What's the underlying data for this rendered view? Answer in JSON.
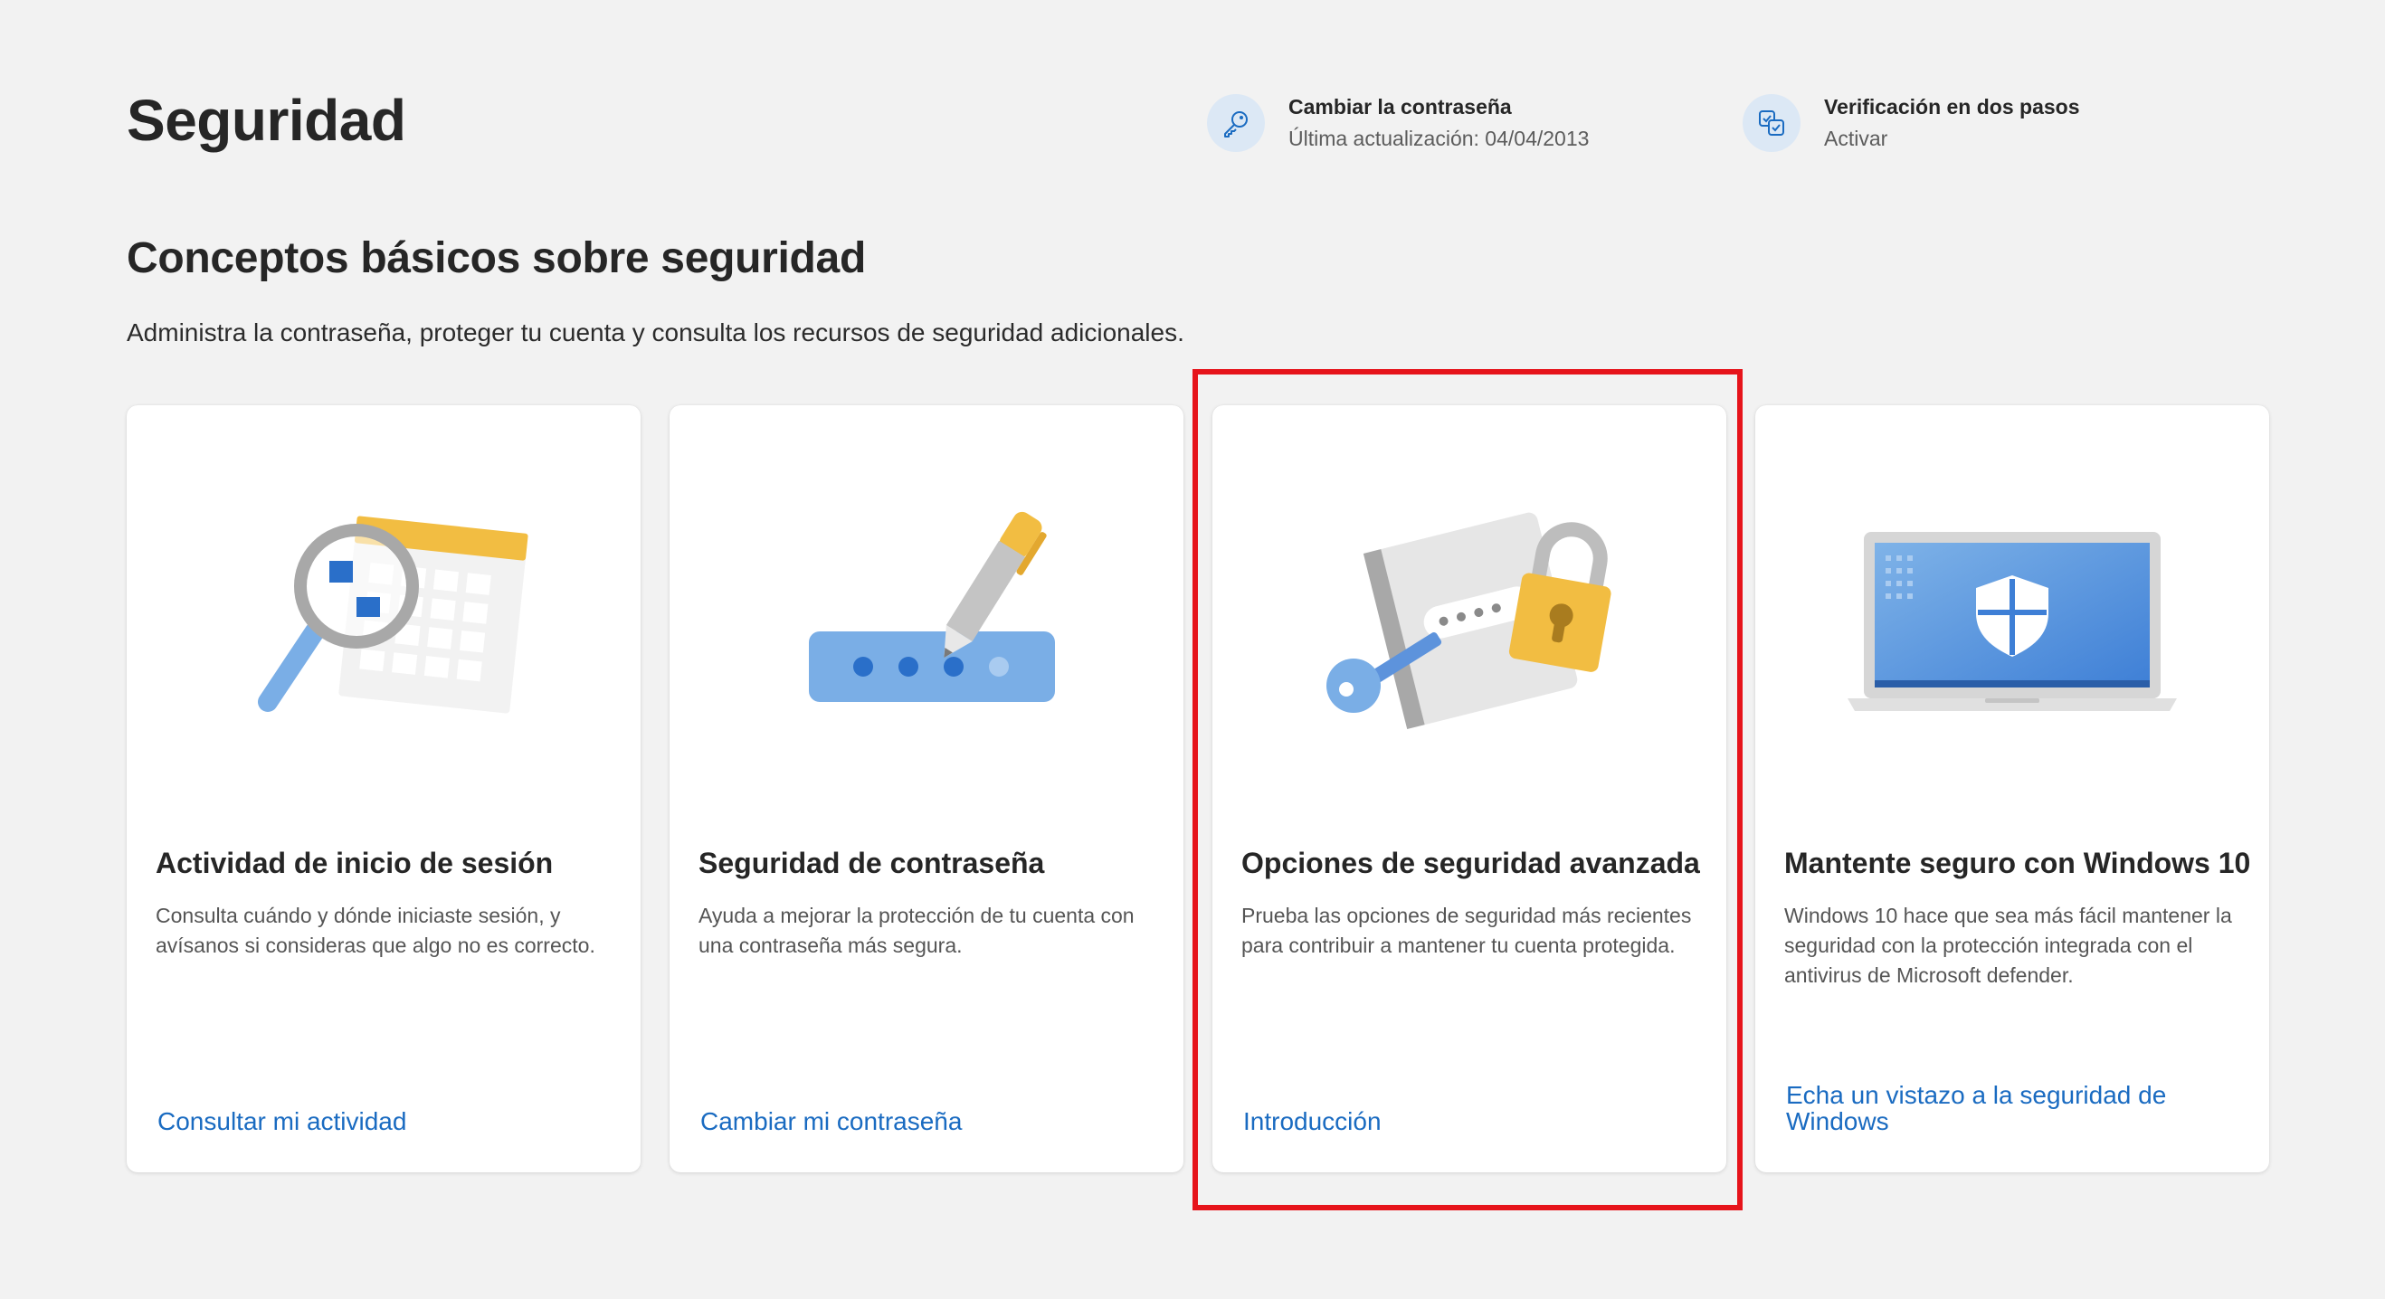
{
  "page": {
    "title": "Seguridad"
  },
  "quick_actions": [
    {
      "icon": "key-icon",
      "title": "Cambiar la contraseña",
      "subtitle": "Última actualización: 04/04/2013"
    },
    {
      "icon": "two-step-verification-icon",
      "title": "Verificación en dos pasos",
      "subtitle": "Activar"
    }
  ],
  "section": {
    "title": "Conceptos básicos sobre seguridad",
    "description": "Administra la contraseña, proteger tu cuenta y consulta los recursos de seguridad adicionales."
  },
  "cards": [
    {
      "illustration": "magnifier-calendar-illustration",
      "title": "Actividad de inicio de sesión",
      "description": "Consulta cuándo y dónde iniciaste sesión, y avísanos si consideras que algo no es correcto.",
      "link": "Consultar mi actividad"
    },
    {
      "illustration": "password-pen-illustration",
      "title": "Seguridad de contraseña",
      "description": "Ayuda a mejorar la protección de tu cuenta con una contraseña más segura.",
      "link": "Cambiar mi contraseña"
    },
    {
      "illustration": "key-notebook-lock-illustration",
      "title": "Opciones de seguridad avanzada",
      "description": "Prueba las opciones de seguridad más recientes para contribuir a mantener tu cuenta protegida.",
      "link": "Introducción"
    },
    {
      "illustration": "laptop-shield-illustration",
      "title": "Mantente seguro con Windows 10",
      "description": "Windows 10 hace que sea más fácil mantener la seguridad con la protección integrada con el antivirus de Microsoft defender.",
      "link": "Echa un vistazo a la seguridad de Windows"
    }
  ],
  "colors": {
    "background": "#f2f2f2",
    "card": "#ffffff",
    "link": "#1a6bc1",
    "highlight": "#e6141b",
    "accent_blue": "#7aaee6",
    "accent_yellow": "#f2bd42"
  }
}
